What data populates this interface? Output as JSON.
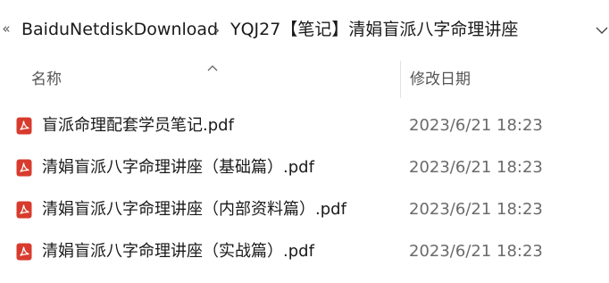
{
  "address_bar": {
    "overflow_glyph": "«",
    "root_folder": "BaiduNetdiskDownload",
    "separator_glyph": "›",
    "current_folder": "YQJ27【笔记】清娟盲派八字命理讲座"
  },
  "columns": {
    "name_label": "名称",
    "date_label": "修改日期",
    "sort": "ascending"
  },
  "files": [
    {
      "name": "盲派命理配套学员笔记.pdf",
      "modified": "2023/6/21 18:23",
      "icon": "pdf-icon"
    },
    {
      "name": "清娟盲派八字命理讲座（基础篇）.pdf",
      "modified": "2023/6/21 18:23",
      "icon": "pdf-icon"
    },
    {
      "name": "清娟盲派八字命理讲座（内部资料篇）.pdf",
      "modified": "2023/6/21 18:23",
      "icon": "pdf-icon"
    },
    {
      "name": "清娟盲派八字命理讲座（实战篇）.pdf",
      "modified": "2023/6/21 18:23",
      "icon": "pdf-icon"
    }
  ],
  "colors": {
    "pdf_icon": "#d83b2d",
    "text": "#1a1a1a",
    "date_text": "#6b6b6b",
    "header_text": "#555555"
  }
}
